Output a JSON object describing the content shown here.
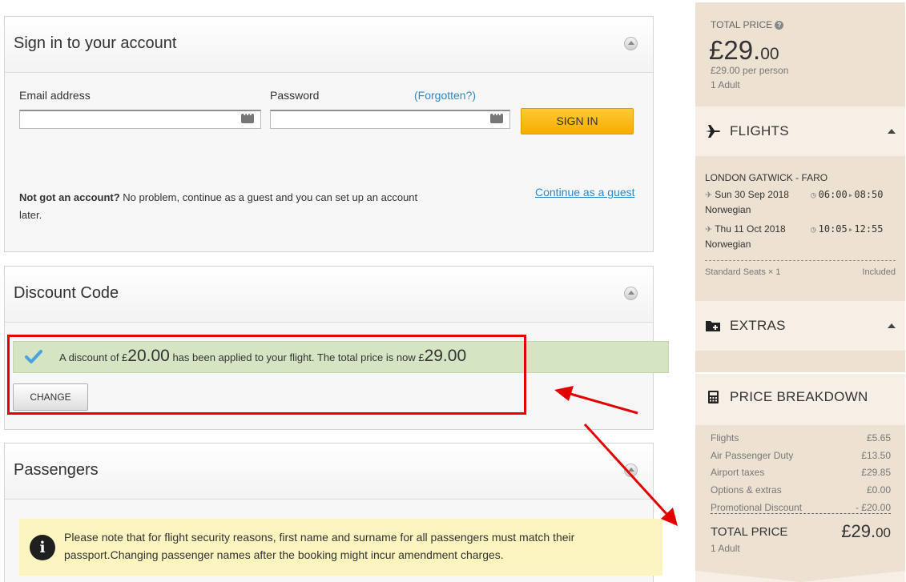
{
  "colors": {
    "accent_link": "#2f89c9",
    "signin_button": "#f6ad00",
    "success_bg": "#d5e4c3",
    "annotation_red": "#e30000",
    "sidebar_bg": "#ede1d2"
  },
  "signin": {
    "title": "Sign in to your account",
    "email_label": "Email address",
    "email_value": "",
    "password_label": "Password",
    "password_value": "",
    "forgot_link": "(Forgotten?)",
    "signin_button": "SIGN IN",
    "guest_bold": "Not got an account?",
    "guest_text": " No problem, continue as a guest and you can set up an account later.",
    "guest_link": "Continue as a guest"
  },
  "discount": {
    "title": "Discount Code",
    "msg_prefix": "A discount of £",
    "msg_amount": "20.00",
    "msg_middle": " has been applied to your flight. The total price is now £",
    "msg_total": "29.00",
    "change_button": "CHANGE"
  },
  "passengers": {
    "title": "Passengers",
    "notice": "Please note that for flight security reasons, first name and surname for all passengers must match their passport.Changing passenger names after the booking might incur amendment charges."
  },
  "sidebar": {
    "total_label": "TOTAL PRICE",
    "total_main": "£29.",
    "total_pence": "00",
    "per_person": "£29.00 per person",
    "adults": "1 Adult",
    "flights": {
      "title": "FLIGHTS",
      "route": "LONDON GATWICK - FARO",
      "legs": [
        {
          "date": "Sun 30 Sep 2018",
          "depart": "06:00",
          "arrive": "08:50",
          "carrier": "Norwegian"
        },
        {
          "date": "Thu 11 Oct 2018",
          "depart": "10:05",
          "arrive": "12:55",
          "carrier": "Norwegian"
        }
      ],
      "seats_label": "Standard Seats × 1",
      "seats_value": "Included"
    },
    "extras": {
      "title": "EXTRAS"
    },
    "breakdown": {
      "title": "PRICE BREAKDOWN",
      "rows": [
        {
          "label": "Flights",
          "value": "£5.65"
        },
        {
          "label": "Air Passenger Duty",
          "value": "£13.50"
        },
        {
          "label": "Airport taxes",
          "value": "£29.85"
        },
        {
          "label": "Options & extras",
          "value": "£0.00"
        },
        {
          "label": "Promotional Discount",
          "value": "- £20.00"
        }
      ],
      "total_label": "TOTAL PRICE",
      "total_adults": "1 Adult",
      "total_main": "£29.",
      "total_pence": "00"
    }
  }
}
